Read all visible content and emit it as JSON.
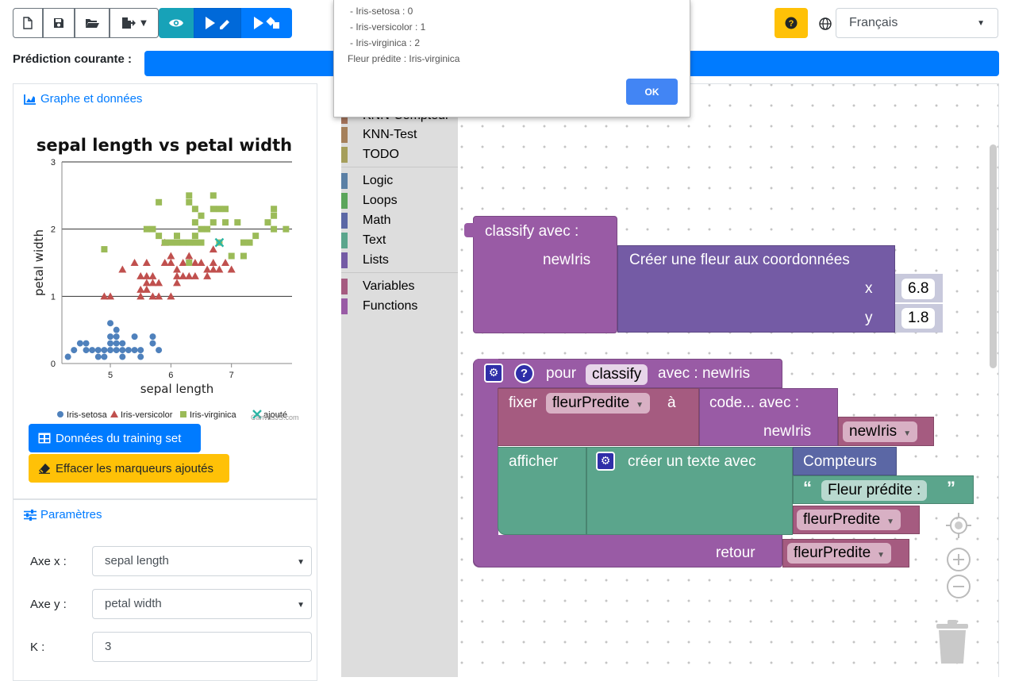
{
  "toolbar": {
    "buttons": [
      {
        "name": "new-file",
        "icon": "file-icon"
      },
      {
        "name": "save",
        "icon": "save-icon"
      },
      {
        "name": "open-folder",
        "icon": "folder-open-icon"
      },
      {
        "name": "export",
        "icon": "export-icon"
      },
      {
        "name": "preview",
        "icon": "eye-icon"
      },
      {
        "name": "run-paint",
        "icon": "play-paint-icon"
      },
      {
        "name": "run-shapes",
        "icon": "play-shapes-icon"
      }
    ],
    "help_icon": "question-icon",
    "language_icon": "globe-icon",
    "language": "Français"
  },
  "prediction": {
    "label": "Prédiction courante :"
  },
  "dialog": {
    "lines": [
      "- Iris-setosa : 0",
      "- Iris-versicolor : 1",
      "- Iris-virginica : 2",
      "Fleur prédite : Iris-virginica"
    ],
    "ok_label": "OK"
  },
  "left_panel": {
    "graph_header": "Graphe et données",
    "training_button": "Données du training set",
    "clear_button": "Effacer les marqueurs ajoutés",
    "params_header": "Paramètres",
    "axe_x_label": "Axe x :",
    "axe_x_value": "sepal length",
    "axe_y_label": "Axe y :",
    "axe_y_value": "petal width",
    "k_label": "K :",
    "k_value": "3"
  },
  "chart_data": {
    "type": "scatter",
    "title": "sepal length vs petal width",
    "xlabel": "sepal length",
    "ylabel": "petal width",
    "xlim": [
      4.2,
      8.0
    ],
    "ylim": [
      0,
      3
    ],
    "x_ticks": [
      5,
      6,
      7
    ],
    "y_ticks": [
      0,
      1,
      2,
      3
    ],
    "credit": "CanvasJS.com",
    "series": [
      {
        "name": "Iris-setosa",
        "marker": "circle",
        "color": "#4f81bc",
        "points": [
          [
            4.3,
            0.1
          ],
          [
            4.4,
            0.2
          ],
          [
            4.6,
            0.2
          ],
          [
            4.6,
            0.3
          ],
          [
            4.7,
            0.2
          ],
          [
            4.8,
            0.2
          ],
          [
            4.8,
            0.1
          ],
          [
            4.9,
            0.2
          ],
          [
            4.9,
            0.1
          ],
          [
            5.0,
            0.2
          ],
          [
            5.0,
            0.3
          ],
          [
            5.0,
            0.4
          ],
          [
            5.0,
            0.6
          ],
          [
            5.1,
            0.2
          ],
          [
            5.1,
            0.3
          ],
          [
            5.1,
            0.4
          ],
          [
            5.1,
            0.5
          ],
          [
            5.2,
            0.2
          ],
          [
            5.2,
            0.1
          ],
          [
            5.3,
            0.2
          ],
          [
            5.4,
            0.2
          ],
          [
            5.4,
            0.4
          ],
          [
            5.5,
            0.2
          ],
          [
            5.5,
            0.1
          ],
          [
            5.7,
            0.3
          ],
          [
            5.7,
            0.4
          ],
          [
            5.8,
            0.2
          ],
          [
            4.5,
            0.3
          ],
          [
            5.2,
            0.3
          ]
        ]
      },
      {
        "name": "Iris-versicolor",
        "marker": "triangle",
        "color": "#c0504e",
        "points": [
          [
            4.9,
            1.0
          ],
          [
            5.0,
            1.0
          ],
          [
            5.2,
            1.4
          ],
          [
            5.4,
            1.5
          ],
          [
            5.5,
            1.3
          ],
          [
            5.5,
            1.1
          ],
          [
            5.5,
            1.0
          ],
          [
            5.6,
            1.3
          ],
          [
            5.6,
            1.1
          ],
          [
            5.6,
            1.5
          ],
          [
            5.7,
            1.3
          ],
          [
            5.7,
            1.0
          ],
          [
            5.8,
            1.2
          ],
          [
            5.8,
            1.0
          ],
          [
            5.9,
            1.5
          ],
          [
            5.9,
            1.8
          ],
          [
            6.0,
            1.0
          ],
          [
            6.0,
            1.6
          ],
          [
            6.0,
            1.5
          ],
          [
            6.1,
            1.3
          ],
          [
            6.1,
            1.2
          ],
          [
            6.1,
            1.4
          ],
          [
            6.2,
            1.5
          ],
          [
            6.2,
            1.3
          ],
          [
            6.3,
            1.5
          ],
          [
            6.3,
            1.3
          ],
          [
            6.4,
            1.5
          ],
          [
            6.4,
            1.3
          ],
          [
            6.5,
            1.5
          ],
          [
            6.6,
            1.4
          ],
          [
            6.6,
            1.3
          ],
          [
            6.7,
            1.5
          ],
          [
            6.7,
            1.4
          ],
          [
            6.7,
            1.7
          ],
          [
            6.8,
            1.4
          ],
          [
            6.9,
            1.5
          ],
          [
            7.0,
            1.4
          ],
          [
            5.7,
            1.2
          ],
          [
            5.6,
            1.2
          ],
          [
            6.3,
            1.6
          ]
        ]
      },
      {
        "name": "Iris-virginica",
        "marker": "square",
        "color": "#9bbb58",
        "points": [
          [
            4.9,
            1.7
          ],
          [
            5.6,
            2.0
          ],
          [
            5.7,
            2.0
          ],
          [
            5.8,
            1.9
          ],
          [
            5.8,
            2.4
          ],
          [
            5.9,
            1.8
          ],
          [
            6.0,
            1.8
          ],
          [
            6.1,
            1.8
          ],
          [
            6.2,
            1.8
          ],
          [
            6.3,
            2.5
          ],
          [
            6.3,
            1.8
          ],
          [
            6.3,
            2.4
          ],
          [
            6.4,
            2.3
          ],
          [
            6.4,
            2.1
          ],
          [
            6.4,
            1.8
          ],
          [
            6.5,
            2.0
          ],
          [
            6.5,
            1.8
          ],
          [
            6.5,
            2.2
          ],
          [
            6.7,
            2.5
          ],
          [
            6.7,
            2.3
          ],
          [
            6.7,
            2.1
          ],
          [
            6.8,
            2.3
          ],
          [
            6.8,
            1.8
          ],
          [
            6.9,
            2.3
          ],
          [
            6.9,
            2.1
          ],
          [
            7.1,
            2.1
          ],
          [
            7.2,
            1.8
          ],
          [
            7.2,
            1.6
          ],
          [
            7.3,
            1.8
          ],
          [
            7.4,
            1.9
          ],
          [
            7.6,
            2.1
          ],
          [
            7.7,
            2.3
          ],
          [
            7.7,
            2.2
          ],
          [
            7.7,
            2.0
          ],
          [
            7.9,
            2.0
          ],
          [
            6.4,
            1.9
          ],
          [
            6.1,
            1.9
          ],
          [
            6.3,
            1.5
          ],
          [
            7.0,
            1.6
          ],
          [
            6.6,
            2.0
          ]
        ]
      },
      {
        "name": "ajouté",
        "marker": "cross",
        "color": "#2bb5a5",
        "points": [
          [
            6.8,
            1.8
          ]
        ]
      }
    ],
    "legend_position": "bottom"
  },
  "toolbox": {
    "categories": [
      {
        "label": "KNN-Compteur",
        "color": "#a5745b"
      },
      {
        "label": "KNN-Test",
        "color": "#a5805b"
      },
      {
        "label": "TODO",
        "color": "#a59e5b"
      },
      {
        "label": "Logic",
        "color": "#5b80a5"
      },
      {
        "label": "Loops",
        "color": "#5ba55b"
      },
      {
        "label": "Math",
        "color": "#5b67a5"
      },
      {
        "label": "Text",
        "color": "#5ba58c"
      },
      {
        "label": "Lists",
        "color": "#745ba5"
      },
      {
        "label": "Variables",
        "color": "#a55b80"
      },
      {
        "label": "Functions",
        "color": "#995ba5"
      }
    ]
  },
  "blocks": {
    "call": {
      "title": "classify  avec :",
      "param_label": "newIris",
      "create_label": "Créer une fleur aux coordonnées",
      "x_label": "x",
      "x_value": "6.8",
      "y_label": "y",
      "y_value": "1.8"
    },
    "def": {
      "prefix": "pour",
      "name": "classify",
      "suffix": "avec : newIris",
      "set_label": "fixer",
      "set_var": "fleurPredite",
      "set_to": "à",
      "code_label": "code...  avec :",
      "code_param": "newIris",
      "code_arg": "newIris",
      "print_label": "afficher",
      "text_label": "créer un texte avec",
      "counters_label": "Compteurs",
      "string_value": "Fleur prédite :",
      "var1": "fleurPredite",
      "return_label": "retour",
      "return_var": "fleurPredite"
    }
  },
  "colors": {
    "procedure": "#995ba5",
    "procedure_dark": "#7a4884",
    "variable": "#a55b80",
    "text": "#5ba58c",
    "math_field": "#c8c9dc",
    "counter": "#5b67a5",
    "accent": "#007bff",
    "warning": "#ffc107",
    "info": "#17a2b8"
  }
}
